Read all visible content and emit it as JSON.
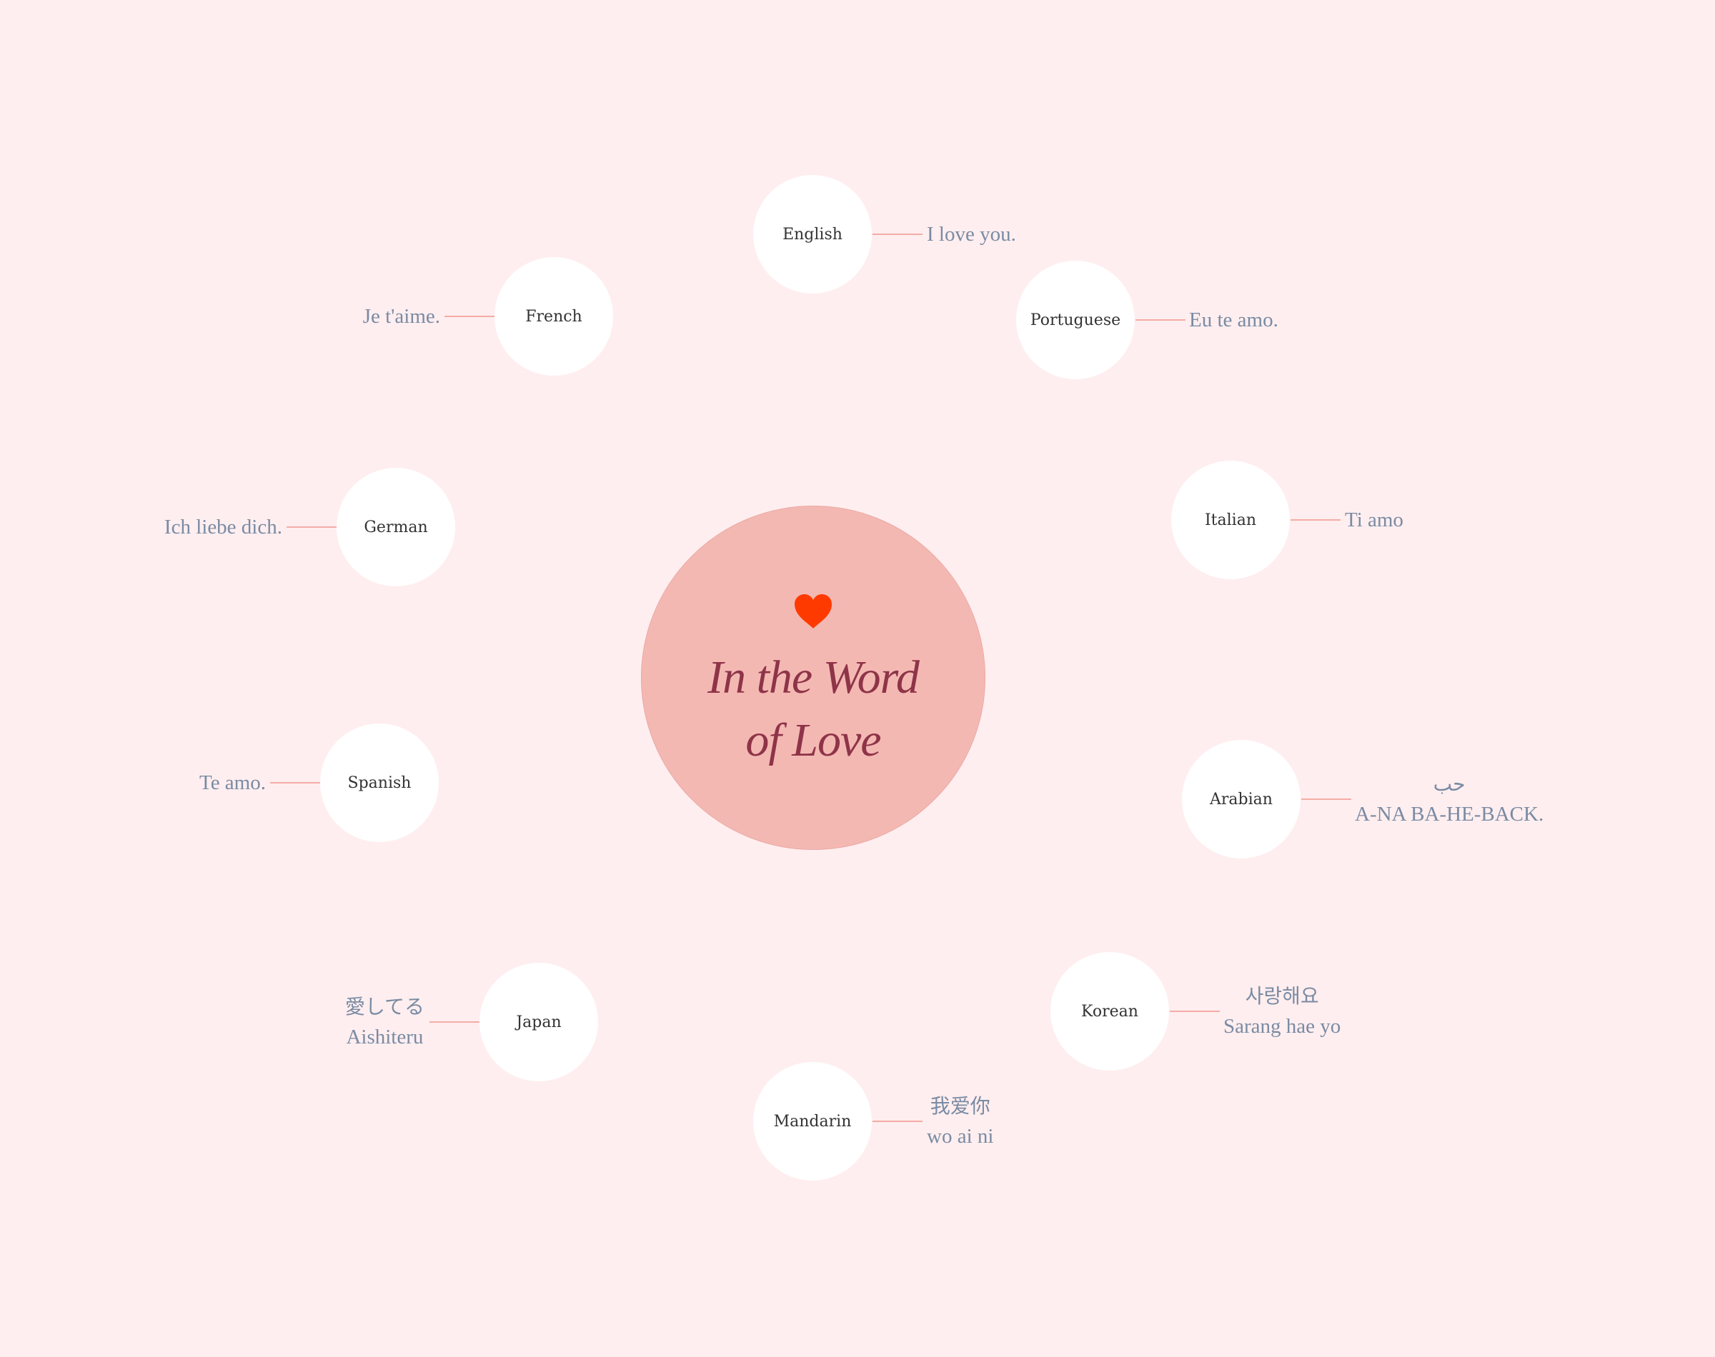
{
  "center": {
    "icon": "heart-icon",
    "heart_color": "#ff3a00",
    "title_line1": "In the Word",
    "title_line2": "of Love"
  },
  "colors": {
    "background": "#ffeeef",
    "center_fill": "#f4b8b3",
    "title": "#8e3448",
    "connector": "#f4aca6",
    "translation_text": "#7a8ba3",
    "node_label": "#333333"
  },
  "languages": [
    {
      "name": "English",
      "native": "",
      "translation": "I love you."
    },
    {
      "name": "Portuguese",
      "native": "",
      "translation": "Eu te amo."
    },
    {
      "name": "Italian",
      "native": "",
      "translation": "Ti amo"
    },
    {
      "name": "Arabian",
      "native": "حب",
      "translation": "A-NA BA-HE-BACK."
    },
    {
      "name": "Korean",
      "native": "사랑해요",
      "translation": "Sarang hae yo"
    },
    {
      "name": "Mandarin",
      "native": "我爱你",
      "translation": "wo ai ni"
    },
    {
      "name": "Japan",
      "native": "愛してる",
      "translation": "Aishiteru"
    },
    {
      "name": "Spanish",
      "native": "",
      "translation": "Te amo."
    },
    {
      "name": "German",
      "native": "",
      "translation": "Ich liebe dich."
    },
    {
      "name": "French",
      "native": "",
      "translation": "Je t'aime."
    }
  ]
}
